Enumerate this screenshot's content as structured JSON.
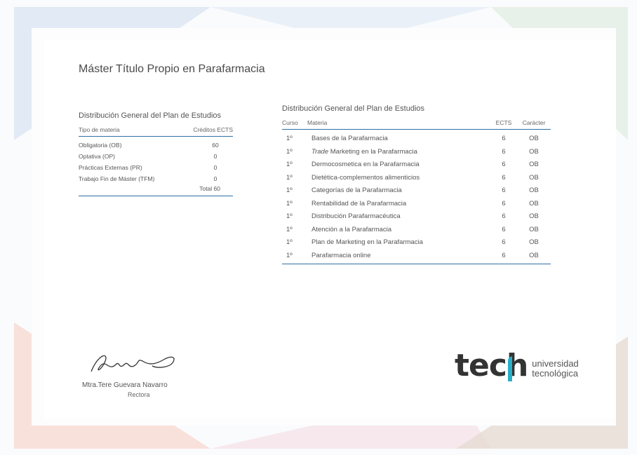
{
  "document": {
    "title": "Máster Título Propio en Parafarmacia"
  },
  "left_table": {
    "heading": "Distribución General del Plan de Estudios",
    "col_type": "Tipo de materia",
    "col_credits": "Créditos ECTS",
    "rows": [
      {
        "type": "Obligatoria (OB)",
        "credits": "60"
      },
      {
        "type": "Optativa (OP)",
        "credits": "0"
      },
      {
        "type": "Prácticas Externas (PR)",
        "credits": "0"
      },
      {
        "type": "Trabajo Fin de Máster (TFM)",
        "credits": "0"
      }
    ],
    "total": "Total 60"
  },
  "right_table": {
    "heading": "Distribución General del Plan de Estudios",
    "col_course": "Curso",
    "col_subject": "Materia",
    "col_ects": "ECTS",
    "col_type": "Carácter",
    "rows": [
      {
        "course": "1º",
        "subject_prefix": "",
        "subject": "Bases de la Parafarmacia",
        "ects": "6",
        "type": "OB"
      },
      {
        "course": "1º",
        "subject_prefix": "Trade",
        "subject": " Marketing en la Parafarmacia",
        "ects": "6",
        "type": "OB"
      },
      {
        "course": "1º",
        "subject_prefix": "",
        "subject": "Dermocosmetica en la Parafarmacia",
        "ects": "6",
        "type": "OB"
      },
      {
        "course": "1º",
        "subject_prefix": "",
        "subject": "Dietética-complementos alimenticios",
        "ects": "6",
        "type": "OB"
      },
      {
        "course": "1º",
        "subject_prefix": "",
        "subject": "Categorías de la Parafarmacia",
        "ects": "6",
        "type": "OB"
      },
      {
        "course": "1º",
        "subject_prefix": "",
        "subject": "Rentabilidad de la Parafarmacia",
        "ects": "6",
        "type": "OB"
      },
      {
        "course": "1º",
        "subject_prefix": "",
        "subject": "Distribución Parafarmacéutica",
        "ects": "6",
        "type": "OB"
      },
      {
        "course": "1º",
        "subject_prefix": "",
        "subject": "Atención a la Parafarmacia",
        "ects": "6",
        "type": "OB"
      },
      {
        "course": "1º",
        "subject_prefix": "",
        "subject": "Plan de Marketing en la Parafarmacia",
        "ects": "6",
        "type": "OB"
      },
      {
        "course": "1º",
        "subject_prefix": "",
        "subject": "Parafarmacia online",
        "ects": "6",
        "type": "OB"
      }
    ]
  },
  "signatory": {
    "name": "Mtra.Tere Guevara Navarro",
    "role": "Rectora"
  },
  "logo": {
    "mark": "tech",
    "line1": "universidad",
    "line2": "tecnológica",
    "accent_color": "#2ab0c6"
  }
}
